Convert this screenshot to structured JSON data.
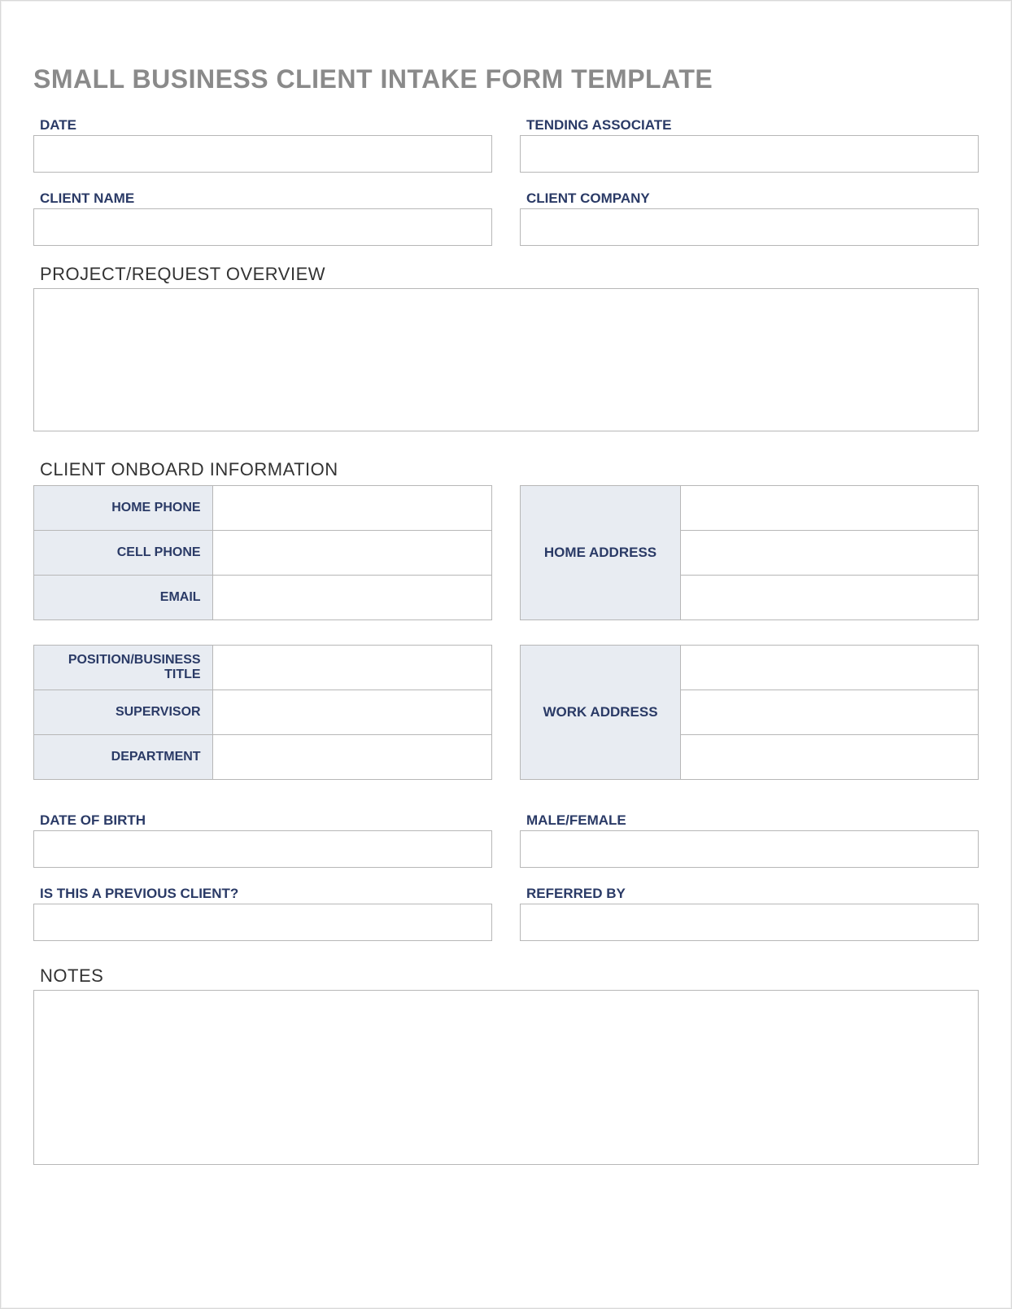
{
  "title": "SMALL BUSINESS CLIENT INTAKE FORM TEMPLATE",
  "top": {
    "date_label": "DATE",
    "date_value": "",
    "associate_label": "TENDING ASSOCIATE",
    "associate_value": "",
    "client_name_label": "CLIENT NAME",
    "client_name_value": "",
    "client_company_label": "CLIENT COMPANY",
    "client_company_value": ""
  },
  "project": {
    "label": "PROJECT/REQUEST OVERVIEW",
    "value": ""
  },
  "onboard": {
    "heading": "CLIENT ONBOARD INFORMATION",
    "block1": {
      "home_phone_label": "HOME PHONE",
      "home_phone_value": "",
      "cell_phone_label": "CELL PHONE",
      "cell_phone_value": "",
      "email_label": "EMAIL",
      "email_value": "",
      "home_address_label": "HOME ADDRESS",
      "home_address_line1": "",
      "home_address_line2": "",
      "home_address_line3": ""
    },
    "block2": {
      "position_label": "POSITION/BUSINESS TITLE",
      "position_value": "",
      "supervisor_label": "SUPERVISOR",
      "supervisor_value": "",
      "department_label": "DEPARTMENT",
      "department_value": "",
      "work_address_label": "WORK ADDRESS",
      "work_address_line1": "",
      "work_address_line2": "",
      "work_address_line3": ""
    }
  },
  "extra": {
    "dob_label": "DATE OF BIRTH",
    "dob_value": "",
    "gender_label": "MALE/FEMALE",
    "gender_value": "",
    "previous_client_label": "IS THIS A PREVIOUS CLIENT?",
    "previous_client_value": "",
    "referred_by_label": "REFERRED BY",
    "referred_by_value": ""
  },
  "notes": {
    "label": "NOTES",
    "value": ""
  }
}
